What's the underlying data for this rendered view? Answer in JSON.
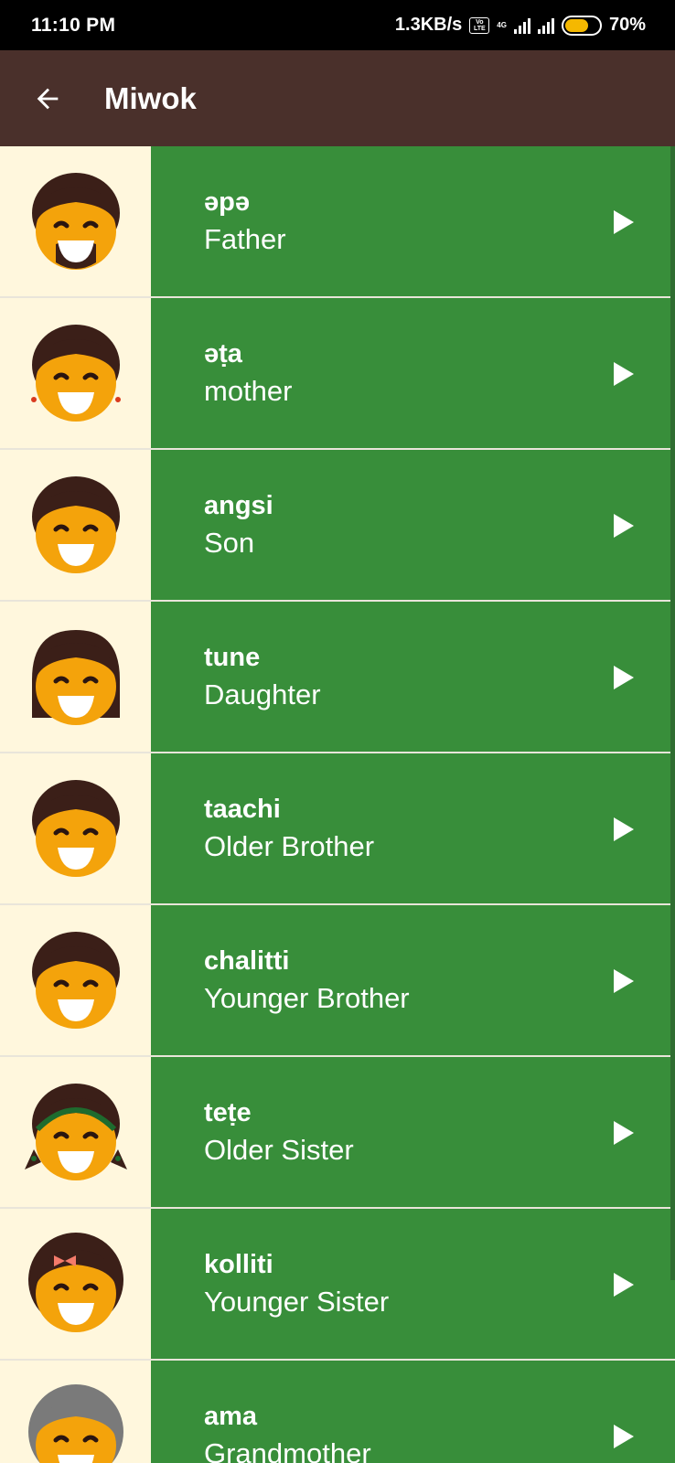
{
  "status_bar": {
    "time": "11:10 PM",
    "net_speed": "1.3KB/s",
    "volte_top": "Vo",
    "volte_bottom": "LTE",
    "net_type": "4G",
    "battery": "70%",
    "battery_level": 0.7
  },
  "app_bar": {
    "title": "Miwok"
  },
  "colors": {
    "app_bar": "#4a302b",
    "row": "#388e3a",
    "thumb_bg": "#fff7dd",
    "skin": "#f4a30b",
    "hair": "#3b1f18"
  },
  "words": [
    {
      "miwok": "əpə",
      "english": "Father",
      "icon": "father-face-icon"
    },
    {
      "miwok": "əṭa",
      "english": "mother",
      "icon": "mother-face-icon"
    },
    {
      "miwok": "angsi",
      "english": "Son",
      "icon": "son-face-icon"
    },
    {
      "miwok": "tune",
      "english": "Daughter",
      "icon": "daughter-face-icon"
    },
    {
      "miwok": "taachi",
      "english": "Older Brother",
      "icon": "older-brother-face-icon"
    },
    {
      "miwok": "chalitti",
      "english": "Younger Brother",
      "icon": "younger-brother-face-icon"
    },
    {
      "miwok": "teṭe",
      "english": "Older Sister",
      "icon": "older-sister-face-icon"
    },
    {
      "miwok": "kolliti",
      "english": "Younger Sister",
      "icon": "younger-sister-face-icon"
    },
    {
      "miwok": "ama",
      "english": "Grandmother",
      "icon": "grandmother-face-icon"
    }
  ]
}
